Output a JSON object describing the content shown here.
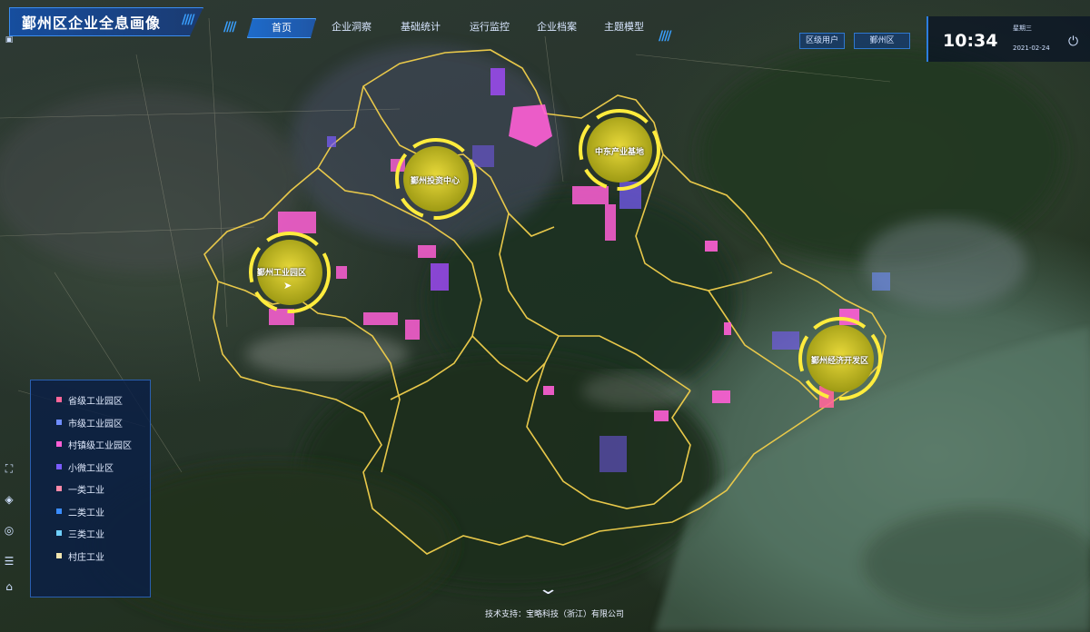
{
  "app": {
    "title": "鄞州区企业全息画像"
  },
  "nav": {
    "tabs": [
      "首页",
      "企业洞察",
      "基础统计",
      "运行监控",
      "企业档案",
      "主题模型"
    ],
    "active_index": 0
  },
  "controls": {
    "mode_button": "区级用户",
    "region_select": "鄞州区"
  },
  "clock": {
    "time": "10:34",
    "weekday": "星期三",
    "date": "2021-02-24"
  },
  "hubs": [
    {
      "label": "鄞州工业园区"
    },
    {
      "label": "鄞州投资中心"
    },
    {
      "label": "中东产业基地"
    },
    {
      "label": "鄞州经济开发区"
    }
  ],
  "legend": {
    "items": [
      {
        "label": "省级工业园区",
        "color": "#ff6699"
      },
      {
        "label": "市级工业园区",
        "color": "#6f8dff"
      },
      {
        "label": "村镇级工业园区",
        "color": "#ff5fd6"
      },
      {
        "label": "小微工业区",
        "color": "#7a5cff"
      },
      {
        "label": "一类工业",
        "color": "#ff8aa8"
      },
      {
        "label": "二类工业",
        "color": "#3a8dff"
      },
      {
        "label": "三类工业",
        "color": "#6fd0ff"
      },
      {
        "label": "村庄工业",
        "color": "#f2e6b0"
      }
    ]
  },
  "footer": {
    "credit": "技术支持：宝略科技（浙江）有限公司"
  },
  "colors": {
    "boundary": "#e8c84a",
    "hub_ring": "#ffec3d",
    "hub_fill": "#c9c21a",
    "accent": "#2b7de0"
  },
  "icons": [
    "power-icon",
    "chevron-down-icon",
    "layers-icon",
    "locate-icon",
    "fullscreen-icon",
    "home-icon",
    "list-icon",
    "pointer-icon"
  ]
}
